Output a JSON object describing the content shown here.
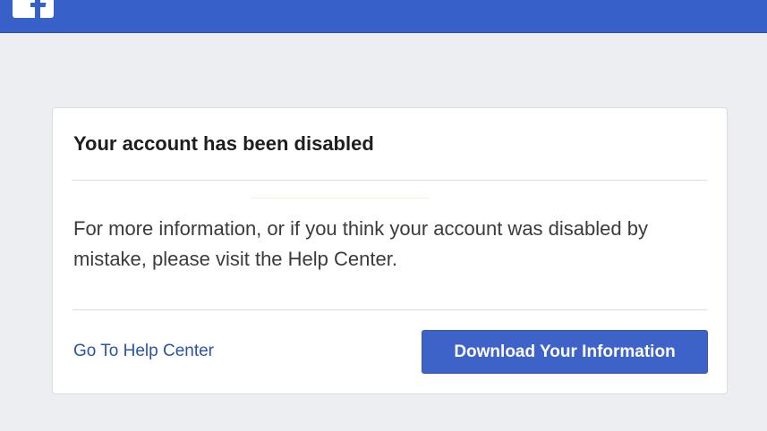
{
  "brand": {
    "logo_icon": "facebook-f-logo-icon",
    "topbar_color": "#3760c8"
  },
  "card": {
    "title": "Your account has been disabled",
    "body": "For more information, or if you think your account was disabled by mistake, please visit the Help Center.",
    "help_link_label": "Go To Help Center",
    "download_button_label": "Download Your Information"
  },
  "colors": {
    "accent": "#3d62c8",
    "link": "#2b54a6",
    "background": "#eceef1"
  }
}
